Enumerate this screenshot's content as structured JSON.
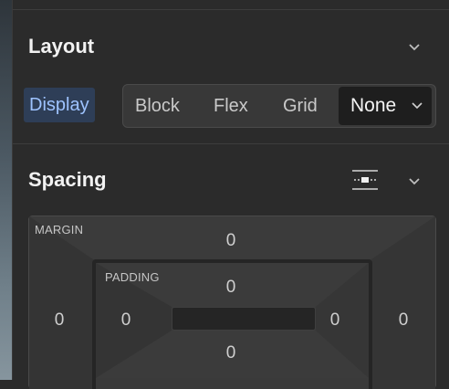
{
  "layout": {
    "title": "Layout",
    "display_label": "Display",
    "options": [
      "Block",
      "Flex",
      "Grid"
    ],
    "selected": "None"
  },
  "spacing": {
    "title": "Spacing",
    "margin": {
      "label": "MARGIN",
      "top": "0",
      "left": "0",
      "right": "0"
    },
    "padding": {
      "label": "PADDING",
      "top": "0",
      "left": "0",
      "right": "0",
      "bottom": "0"
    }
  },
  "icons": {
    "layout_toggle": "chevron-down-icon",
    "spacing_toggle": "chevron-down-icon",
    "spacing_mode": "align-center-icon",
    "select_arrow": "chevron-down-icon"
  },
  "colors": {
    "panel_bg": "#2b2b2b",
    "accent_label_bg": "#2e3e57",
    "accent_label_text": "#9ec3ff",
    "selected_bg": "#1e1e1e"
  }
}
